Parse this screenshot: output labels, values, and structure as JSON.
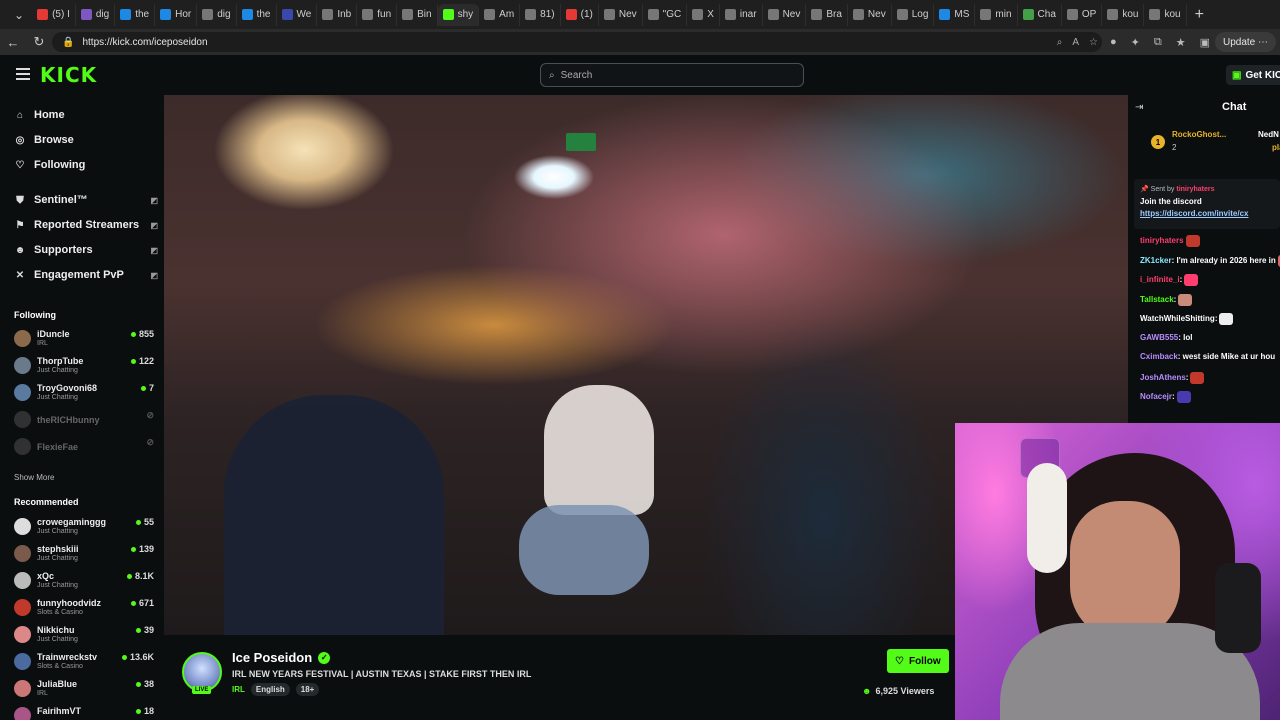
{
  "browser": {
    "tabs": [
      {
        "label": "(5) I",
        "color": "#e53935"
      },
      {
        "label": "dig",
        "color": "#7e57c2"
      },
      {
        "label": "the",
        "color": "#1e88e5"
      },
      {
        "label": "Hor",
        "color": "#1e88e5"
      },
      {
        "label": "dig",
        "color": "#777"
      },
      {
        "label": "the",
        "color": "#1e88e5"
      },
      {
        "label": "We",
        "color": "#3949ab"
      },
      {
        "label": "Inb",
        "color": "#777"
      },
      {
        "label": "fun",
        "color": "#777"
      },
      {
        "label": "Bin",
        "color": "#777"
      },
      {
        "label": "shy",
        "color": "#53fc18"
      },
      {
        "label": "Am",
        "color": "#777"
      },
      {
        "label": "81)",
        "color": "#777"
      },
      {
        "label": "(1)",
        "color": "#e53935"
      },
      {
        "label": "Nev",
        "color": "#777"
      },
      {
        "label": "\"GC",
        "color": "#777"
      },
      {
        "label": "X",
        "color": "#777"
      },
      {
        "label": "inar",
        "color": "#777"
      },
      {
        "label": "Nev",
        "color": "#777"
      },
      {
        "label": "Bra",
        "color": "#777"
      },
      {
        "label": "Nev",
        "color": "#777"
      },
      {
        "label": "Log",
        "color": "#777"
      },
      {
        "label": "MS",
        "color": "#1e88e5"
      },
      {
        "label": "min",
        "color": "#777"
      },
      {
        "label": "Cha",
        "color": "#43a047"
      },
      {
        "label": "OP",
        "color": "#777"
      },
      {
        "label": "kou",
        "color": "#777"
      },
      {
        "label": "kou",
        "color": "#777"
      }
    ],
    "url": "https://kick.com/iceposeidon",
    "update_label": "Update"
  },
  "header": {
    "logo": "KICK",
    "search_placeholder": "Search",
    "get_kick": "Get KICK"
  },
  "sidebar": {
    "nav": [
      {
        "label": "Home",
        "icon": "home-icon"
      },
      {
        "label": "Browse",
        "icon": "compass-icon"
      },
      {
        "label": "Following",
        "icon": "heart-icon"
      }
    ],
    "extensions": [
      {
        "label": "Sentinel™",
        "icon": "shield-icon"
      },
      {
        "label": "Reported Streamers",
        "icon": "flag-icon"
      },
      {
        "label": "Supporters",
        "icon": "people-icon"
      },
      {
        "label": "Engagement PvP",
        "icon": "swords-icon"
      }
    ],
    "following_title": "Following",
    "following": [
      {
        "name": "iDuncle",
        "category": "IRL",
        "viewers": "855",
        "avatar": "#8a6a4a"
      },
      {
        "name": "ThorpTube",
        "category": "Just Chatting",
        "viewers": "122",
        "avatar": "#6a7a8a"
      },
      {
        "name": "TroyGovoni68",
        "category": "Just Chatting",
        "viewers": "7",
        "avatar": "#5a7aa0"
      },
      {
        "name": "theRICHbunny",
        "category": "",
        "viewers": "",
        "avatar": "#666"
      },
      {
        "name": "FlexieFae",
        "category": "",
        "viewers": "",
        "avatar": "#666"
      }
    ],
    "show_more": "Show More",
    "recommended_title": "Recommended",
    "recommended": [
      {
        "name": "crowegaminggg",
        "category": "Just Chatting",
        "viewers": "55",
        "avatar": "#ddd"
      },
      {
        "name": "stephskiii",
        "category": "Just Chatting",
        "viewers": "139",
        "avatar": "#7a5a4a"
      },
      {
        "name": "xQc",
        "category": "Just Chatting",
        "viewers": "8.1K",
        "avatar": "#bbb"
      },
      {
        "name": "funnyhoodvidz",
        "category": "Slots & Casino",
        "viewers": "671",
        "avatar": "#c0392b"
      },
      {
        "name": "Nikkichu",
        "category": "Just Chatting",
        "viewers": "39",
        "avatar": "#d88"
      },
      {
        "name": "Trainwreckstv",
        "category": "Slots & Casino",
        "viewers": "13.6K",
        "avatar": "#4a6aa0"
      },
      {
        "name": "JuliaBlue",
        "category": "IRL",
        "viewers": "38",
        "avatar": "#c77"
      },
      {
        "name": "FairihmVT",
        "category": "",
        "viewers": "18",
        "avatar": "#a58"
      }
    ]
  },
  "stream": {
    "name": "Ice Poseidon",
    "live": "LIVE",
    "title": "IRL NEW YEARS FESTIVAL | AUSTIN TEXAS | STAKE FIRST THEN IRL",
    "category": "IRL",
    "tags": [
      "English",
      "18+"
    ],
    "follow": "Follow",
    "viewers": "6,925 Viewers"
  },
  "chat": {
    "title": "Chat",
    "top_gifter": {
      "rank": "1",
      "name": "RockoGhost...",
      "count": "2",
      "name2": "NedN",
      "tier": "platin"
    },
    "pinned": {
      "sent_by": "Sent by",
      "user": "tiniryhaters",
      "message": "Join the discord",
      "link": "https://discord.com/invite/cx"
    },
    "messages": [
      {
        "user": "tiniryhaters",
        "text": "",
        "color": "#ff3d6e"
      },
      {
        "user": "ZK1cker",
        "text": ": I'm already in 2026 here in",
        "color": "#8be9fd"
      },
      {
        "user": "i_infinite_i",
        "text": ":",
        "color": "#ff3d6e"
      },
      {
        "user": "Tallstack",
        "text": ":",
        "color": "#53fc18"
      },
      {
        "user": "WatchWhileShitting",
        "text": ":",
        "color": "#ffffff"
      },
      {
        "user": "GAWB555",
        "text": ": lol",
        "color": "#b88cff"
      },
      {
        "user": "Cximback",
        "text": ": west side Mike at ur hou",
        "color": "#b88cff"
      },
      {
        "user": "JoshAthens",
        "text": ":",
        "color": "#b88cff"
      },
      {
        "user": "Nofacejr",
        "text": ":",
        "color": "#b88cff"
      }
    ]
  },
  "colors": {
    "accent": "#53fc18",
    "bg": "#0b0e0f"
  }
}
